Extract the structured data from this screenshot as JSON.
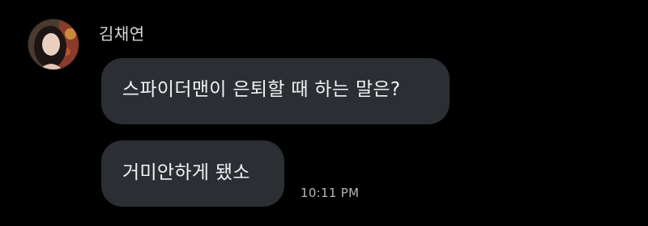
{
  "conversation": {
    "sender": {
      "name": "김채연"
    },
    "messages": [
      {
        "text": "스파이더맨이 은퇴할 때 하는 말은?"
      },
      {
        "text": "거미안하게 됐소"
      }
    ],
    "last_timestamp": "10:11 PM"
  },
  "colors": {
    "background": "#000000",
    "bubble": "#2b2e33",
    "message_text": "#f1f2f4",
    "name_text": "#d7d9dc",
    "timestamp_text": "#b5b8bc"
  }
}
